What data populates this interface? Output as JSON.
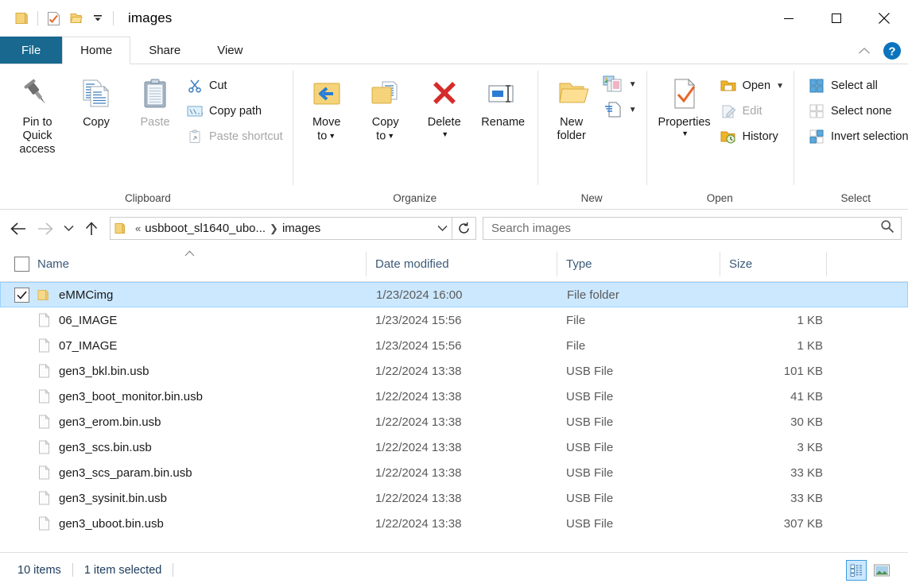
{
  "window": {
    "title": "images",
    "quick_access": [
      {
        "name": "folder-icon",
        "label": "Folder"
      },
      {
        "name": "properties-icon",
        "label": "Properties"
      },
      {
        "name": "new-folder-icon",
        "label": "New folder"
      },
      {
        "name": "customize-qat-icon",
        "label": "Customize Quick Access Toolbar"
      }
    ],
    "controls": [
      {
        "name": "minimize-button",
        "label": "Minimize"
      },
      {
        "name": "maximize-button",
        "label": "Maximize"
      },
      {
        "name": "close-button",
        "label": "Close"
      }
    ]
  },
  "tabs": [
    {
      "label": "File",
      "active": false,
      "kind": "file"
    },
    {
      "label": "Home",
      "active": true,
      "kind": "normal"
    },
    {
      "label": "Share",
      "active": false,
      "kind": "normal"
    },
    {
      "label": "View",
      "active": false,
      "kind": "normal"
    }
  ],
  "ribbon_right": {
    "collapse_label": "Minimize the Ribbon",
    "help_label": "?"
  },
  "ribbon": {
    "groups": [
      {
        "label": "Clipboard",
        "big": [
          {
            "label_line1": "Pin to Quick",
            "label_line2": "access",
            "icon": "pin-icon",
            "disabled": false
          },
          {
            "label_line1": "Copy",
            "label_line2": "",
            "icon": "copy-icon",
            "disabled": false
          },
          {
            "label_line1": "Paste",
            "label_line2": "",
            "icon": "paste-icon",
            "disabled": true
          }
        ],
        "small": [
          {
            "label": "Cut",
            "icon": "scissors-icon",
            "disabled": false
          },
          {
            "label": "Copy path",
            "icon": "copy-path-icon",
            "disabled": false
          },
          {
            "label": "Paste shortcut",
            "icon": "paste-shortcut-icon",
            "disabled": true
          }
        ]
      },
      {
        "label": "Organize",
        "big": [
          {
            "label_line1": "Move",
            "label_line2": "to",
            "icon": "move-to-icon",
            "disabled": false,
            "dropdown": true
          },
          {
            "label_line1": "Copy",
            "label_line2": "to",
            "icon": "copy-to-icon",
            "disabled": false,
            "dropdown": true
          },
          {
            "label_line1": "Delete",
            "label_line2": "",
            "icon": "delete-icon",
            "disabled": false,
            "dropdown_below": true
          },
          {
            "label_line1": "Rename",
            "label_line2": "",
            "icon": "rename-icon",
            "disabled": false
          }
        ],
        "small": []
      },
      {
        "label": "New",
        "big": [
          {
            "label_line1": "New",
            "label_line2": "folder",
            "icon": "new-folder-icon",
            "disabled": false
          }
        ],
        "small": [
          {
            "label": "",
            "icon": "new-item-icon",
            "disabled": false,
            "dropdown": true
          },
          {
            "label": "",
            "icon": "easy-access-icon",
            "disabled": false,
            "dropdown": true
          }
        ]
      },
      {
        "label": "Open",
        "big": [
          {
            "label_line1": "Properties",
            "label_line2": "",
            "icon": "properties-icon",
            "disabled": false,
            "dropdown_below": true
          }
        ],
        "small": [
          {
            "label": "Open",
            "icon": "open-icon",
            "disabled": false,
            "dropdown": true
          },
          {
            "label": "Edit",
            "icon": "edit-icon",
            "disabled": true
          },
          {
            "label": "History",
            "icon": "history-icon",
            "disabled": false
          }
        ]
      },
      {
        "label": "Select",
        "big": [],
        "small": [
          {
            "label": "Select all",
            "icon": "select-all-icon",
            "disabled": false
          },
          {
            "label": "Select none",
            "icon": "select-none-icon",
            "disabled": true
          },
          {
            "label": "Invert selection",
            "icon": "invert-selection-icon",
            "disabled": false
          }
        ]
      }
    ]
  },
  "navigation": {
    "back_label": "Back",
    "forward_label": "Forward",
    "recent_label": "Recent locations",
    "up_label": "Up",
    "refresh_label": "Refresh",
    "breadcrumb": {
      "overflow": "«",
      "parent": "usbboot_sl1640_ubo...",
      "separator": "❯",
      "current": "images",
      "dropdown_label": "Previous locations"
    }
  },
  "search": {
    "placeholder": "Search images",
    "icon": "search-icon"
  },
  "columns": [
    {
      "key": "name",
      "label": "Name",
      "sorted": "asc"
    },
    {
      "key": "date",
      "label": "Date modified",
      "sorted": ""
    },
    {
      "key": "type",
      "label": "Type",
      "sorted": ""
    },
    {
      "key": "size",
      "label": "Size",
      "sorted": ""
    }
  ],
  "files": [
    {
      "name": "eMMCimg",
      "date": "1/23/2024 16:00",
      "type": "File folder",
      "size": "",
      "icon": "folder-icon",
      "selected": true,
      "checked": true
    },
    {
      "name": "06_IMAGE",
      "date": "1/23/2024 15:56",
      "type": "File",
      "size": "1 KB",
      "icon": "file-icon",
      "selected": false,
      "checked": false
    },
    {
      "name": "07_IMAGE",
      "date": "1/23/2024 15:56",
      "type": "File",
      "size": "1 KB",
      "icon": "file-icon",
      "selected": false,
      "checked": false
    },
    {
      "name": "gen3_bkl.bin.usb",
      "date": "1/22/2024 13:38",
      "type": "USB File",
      "size": "101 KB",
      "icon": "file-icon",
      "selected": false,
      "checked": false
    },
    {
      "name": "gen3_boot_monitor.bin.usb",
      "date": "1/22/2024 13:38",
      "type": "USB File",
      "size": "41 KB",
      "icon": "file-icon",
      "selected": false,
      "checked": false
    },
    {
      "name": "gen3_erom.bin.usb",
      "date": "1/22/2024 13:38",
      "type": "USB File",
      "size": "30 KB",
      "icon": "file-icon",
      "selected": false,
      "checked": false
    },
    {
      "name": "gen3_scs.bin.usb",
      "date": "1/22/2024 13:38",
      "type": "USB File",
      "size": "3 KB",
      "icon": "file-icon",
      "selected": false,
      "checked": false
    },
    {
      "name": "gen3_scs_param.bin.usb",
      "date": "1/22/2024 13:38",
      "type": "USB File",
      "size": "33 KB",
      "icon": "file-icon",
      "selected": false,
      "checked": false
    },
    {
      "name": "gen3_sysinit.bin.usb",
      "date": "1/22/2024 13:38",
      "type": "USB File",
      "size": "33 KB",
      "icon": "file-icon",
      "selected": false,
      "checked": false
    },
    {
      "name": "gen3_uboot.bin.usb",
      "date": "1/22/2024 13:38",
      "type": "USB File",
      "size": "307 KB",
      "icon": "file-icon",
      "selected": false,
      "checked": false
    }
  ],
  "status": {
    "item_count": "10 items",
    "selection": "1 item selected",
    "views": [
      {
        "name": "details-view-button",
        "label": "Details",
        "active": true
      },
      {
        "name": "large-icons-view-button",
        "label": "Large icons",
        "active": false
      }
    ]
  },
  "colors": {
    "file_tab": "#18688f",
    "selection": "#cce8ff",
    "selection_border": "#99d1ff",
    "folder_yellow": "#ffd77a",
    "accent_blue": "#0078d7",
    "header_text": "#3c5a78",
    "delete_red": "#d62b2b"
  }
}
